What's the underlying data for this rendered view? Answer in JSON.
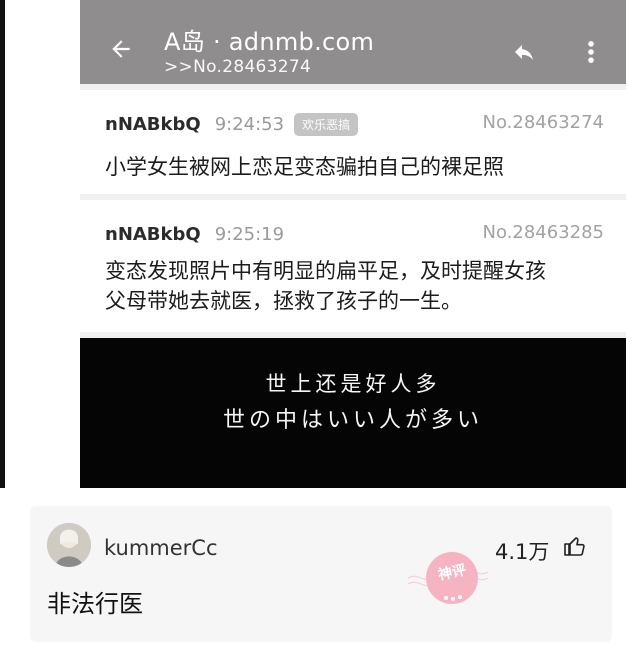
{
  "screenshot": {
    "app_title": "A岛 · adnmb.com",
    "app_subtitle": ">>No.28463274",
    "posts": [
      {
        "user": "nNABkbQ",
        "time": "9:24:53",
        "tag": "欢乐恶搞",
        "no": "No.28463274",
        "text": "小学女生被网上恋足变态骗拍自己的裸足照"
      },
      {
        "user": "nNABkbQ",
        "time": "9:25:19",
        "no": "No.28463285",
        "text_line1": "变态发现照片中有明显的扁平足，及时提醒女孩",
        "text_line2": "父母带她去就医，拯救了孩子的一生。"
      }
    ],
    "subtitle_line1": "世上还是好人多",
    "subtitle_line2": "世の中はいい人が多い"
  },
  "comment": {
    "username": "kummerCc",
    "likes": "4.1万",
    "text": "非法行医",
    "badge": "神评"
  },
  "colors": {
    "appbar": "#8f8d8e",
    "card": "#f6f6f6",
    "badge": "#f6b4c2"
  },
  "icons": [
    "back-arrow-icon",
    "reply-icon",
    "more-vert-icon",
    "thumb-up-icon",
    "avatar"
  ]
}
